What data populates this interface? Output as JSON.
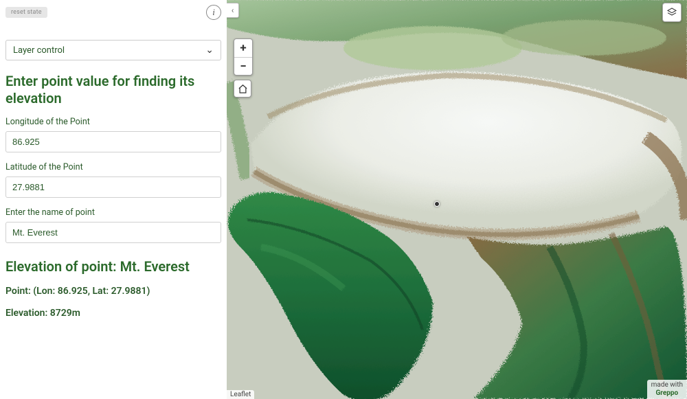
{
  "topbar": {
    "chip": "reset state"
  },
  "layer_control": {
    "label": "Layer control"
  },
  "form": {
    "title": "Enter point value for finding its elevation",
    "lon_label": "Longitude of the Point",
    "lon_value": "86.925",
    "lat_label": "Latitude of the Point",
    "lat_value": "27.9881",
    "name_label": "Enter the name of point",
    "name_value": "Mt. Everest"
  },
  "result": {
    "title": "Elevation of point: Mt. Everest",
    "point_line": "Point: (Lon: 86.925, Lat: 27.9881)",
    "elev_line": "Elevation: 8729m"
  },
  "map": {
    "collapse_glyph": "‹",
    "zoom_in": "+",
    "zoom_out": "−",
    "attribution_left": "Leaflet",
    "made_with": "made with",
    "brand": "Greppo"
  }
}
